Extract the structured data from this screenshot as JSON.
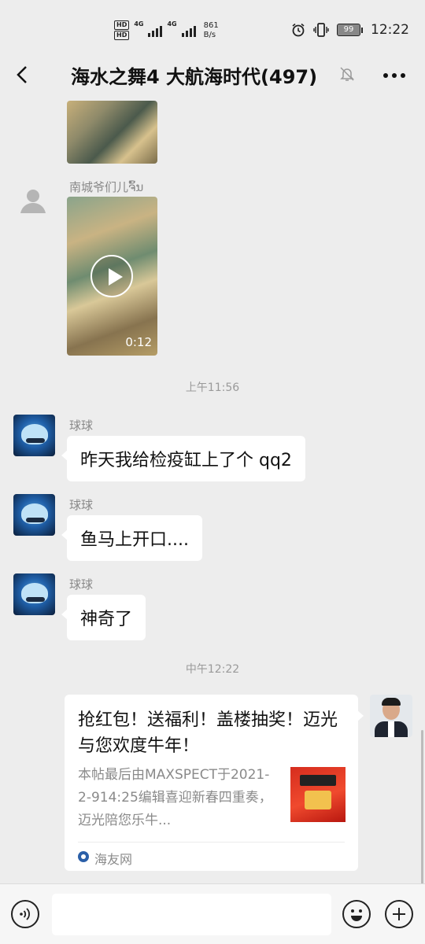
{
  "status_bar": {
    "network_1": "4G",
    "network_2": "4G",
    "speed_value": "861",
    "speed_unit": "B/s",
    "battery": "99",
    "time": "12:22",
    "icons": [
      "hd-icon",
      "signal-icon",
      "alarm-icon",
      "vibrate-icon",
      "battery-icon"
    ]
  },
  "header": {
    "title": "海水之舞4 大航海时代(497)",
    "icons": [
      "back-icon",
      "mute-icon",
      "more-icon"
    ]
  },
  "messages": [
    {
      "type": "image",
      "sender": "",
      "partial": true
    },
    {
      "type": "video",
      "sender": "南城爷们儿ຈົ້ນ",
      "duration": "0:12"
    },
    {
      "type": "time",
      "text": "上午11:56"
    },
    {
      "type": "text",
      "sender": "球球",
      "text": "昨天我给检疫缸上了个 qq2"
    },
    {
      "type": "text",
      "sender": "球球",
      "text": "鱼马上开口...."
    },
    {
      "type": "text",
      "sender": "球球",
      "text": "神奇了"
    },
    {
      "type": "time",
      "text": "中午12:22"
    },
    {
      "type": "link_card",
      "sender": "self",
      "title": "抢红包！送福利！盖楼抽奖！迈光与您欢度牛年！",
      "description": "本帖最后由MAXSPECT于2021-2-914:25编辑喜迎新春四重奏，迈光陪您乐牛...",
      "source": "海友网"
    }
  ],
  "input_bar": {
    "placeholder": "",
    "icons": [
      "voice-icon",
      "emoji-icon",
      "plus-icon"
    ]
  }
}
